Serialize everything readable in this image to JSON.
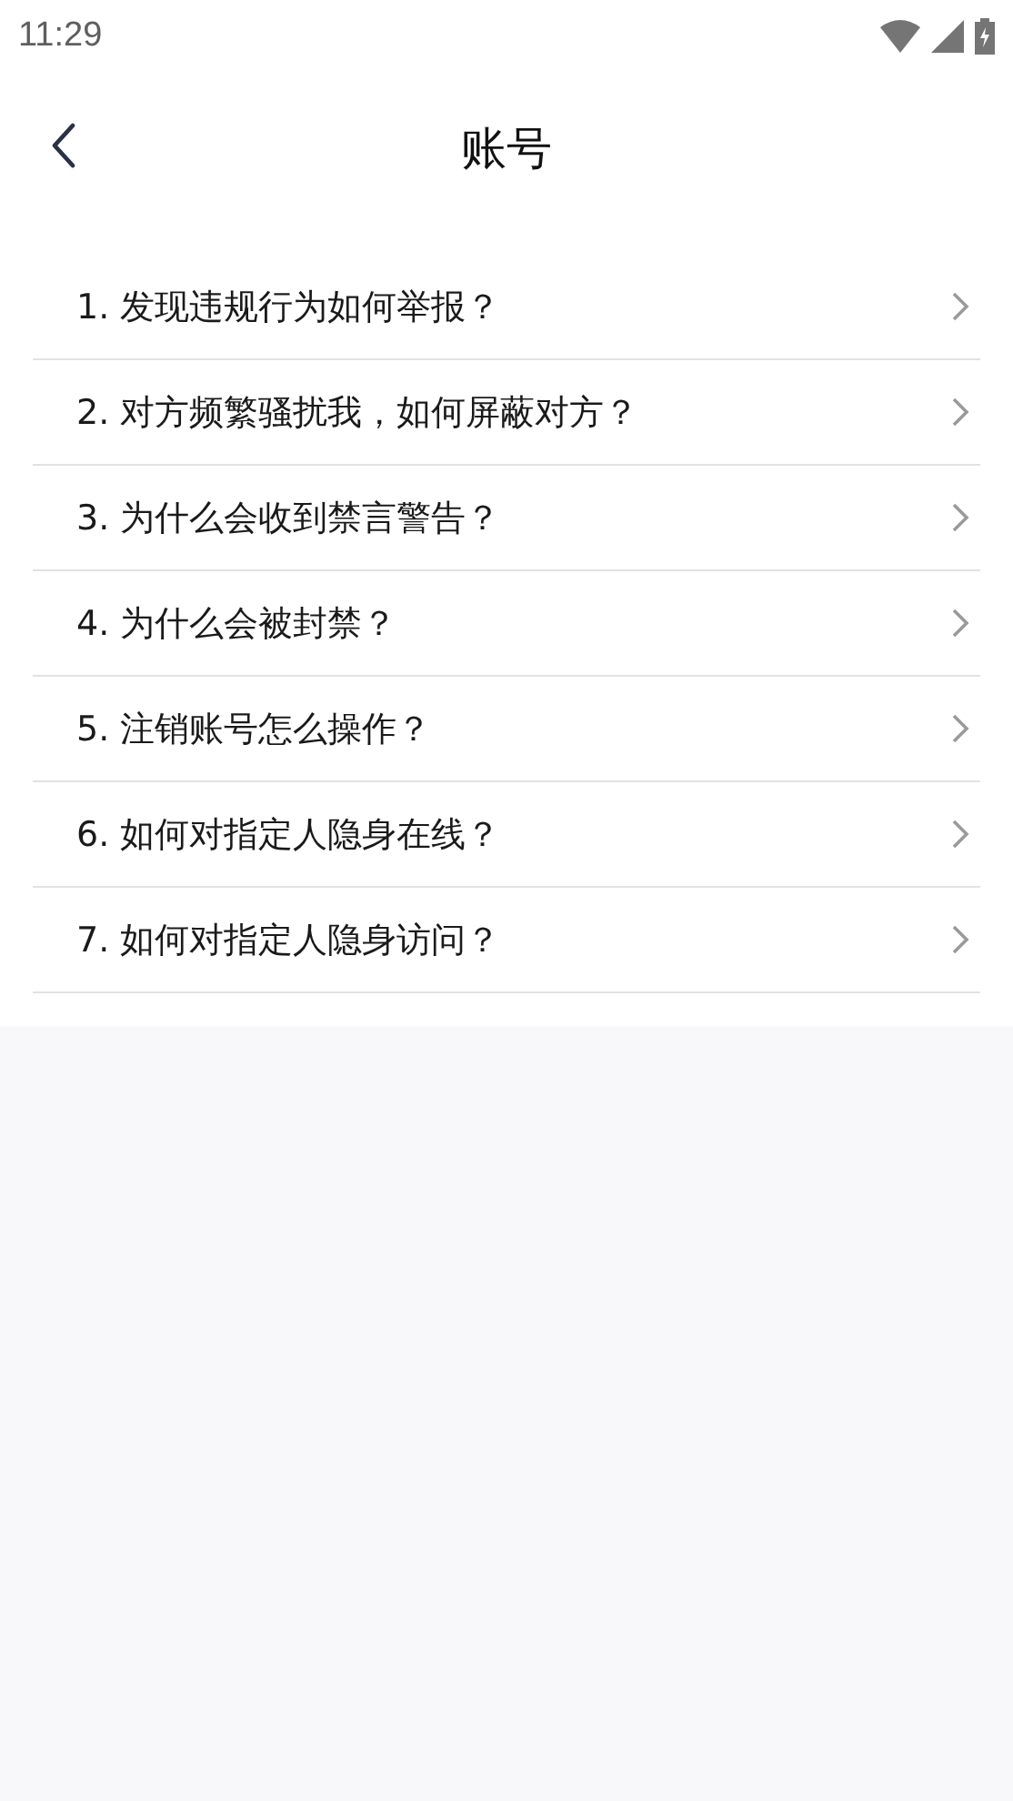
{
  "status_bar": {
    "time": "11:29"
  },
  "header": {
    "title": "账号"
  },
  "items": [
    {
      "label": "1. 发现违规行为如何举报？"
    },
    {
      "label": "2. 对方频繁骚扰我，如何屏蔽对方？"
    },
    {
      "label": "3. 为什么会收到禁言警告？"
    },
    {
      "label": "4. 为什么会被封禁？"
    },
    {
      "label": "5. 注销账号怎么操作？"
    },
    {
      "label": "6. 如何对指定人隐身在线？"
    },
    {
      "label": "7. 如何对指定人隐身访问？"
    }
  ]
}
